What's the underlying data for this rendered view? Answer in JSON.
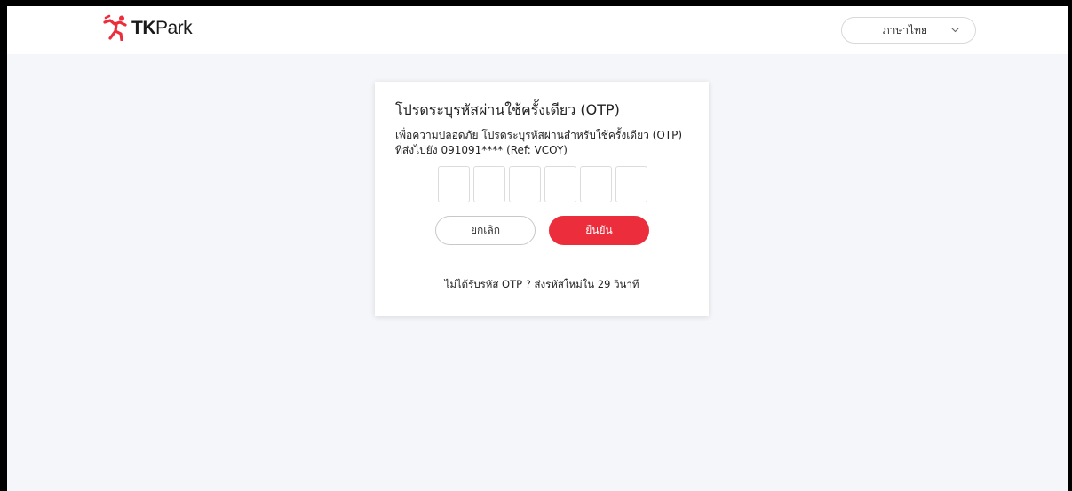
{
  "header": {
    "logo": {
      "text_bold": "TK",
      "text_regular": "Park",
      "icon": "running-figure-icon",
      "brand_color": "#ec2d3c"
    },
    "language_select": {
      "value": "ภาษาไทย",
      "icon": "chevron-down-icon"
    }
  },
  "otp_dialog": {
    "title": "โปรดระบุรหัสผ่านใช้ครั้งเดียว (OTP)",
    "description_line1": "เพื่อความปลอดภัย โปรดระบุรหัสผ่านสำหรับใช้ครั้งเดียว (OTP)",
    "description_line2": "ที่ส่งไปยัง 091091**** (Ref: VCOY)",
    "otp_inputs": [
      "",
      "",
      "",
      "",
      "",
      ""
    ],
    "cancel_label": "ยกเลิก",
    "confirm_label": "ยืนยัน",
    "resend_text": "ไม่ได้รับรหัส OTP ? ส่งรหัสใหม่ใน 29 วินาที"
  },
  "colors": {
    "accent": "#ec2d3c",
    "page_background": "#f4f6fa",
    "card_background": "#ffffff"
  }
}
